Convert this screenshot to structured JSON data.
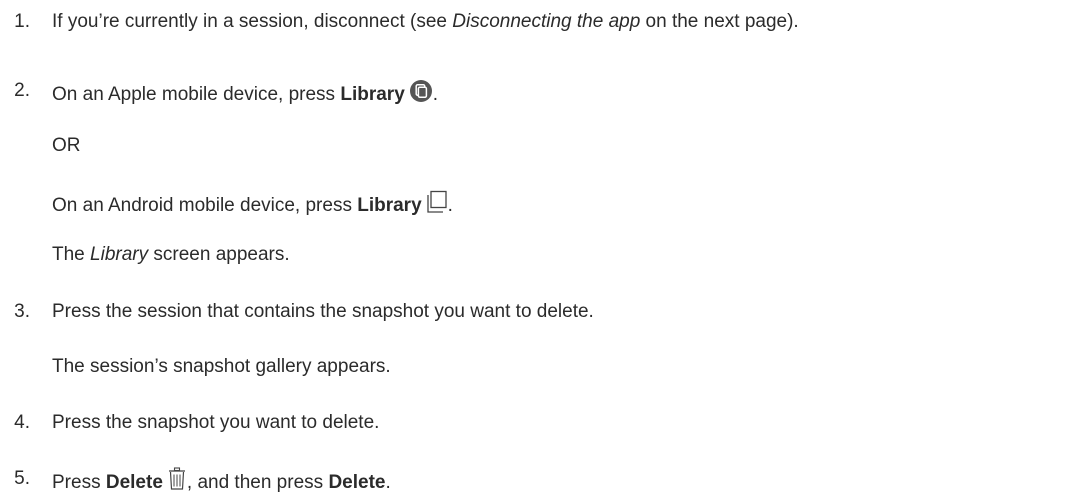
{
  "steps": [
    {
      "number": "1.",
      "text_before": "If you’re currently in a session, disconnect (see ",
      "text_italic": "Disconnecting the app",
      "text_after": " on the next page)."
    },
    {
      "number": "2.",
      "text_before": "On an Apple mobile device, press ",
      "bold": "Library",
      "text_after": ".",
      "icon": "library-circle-icon"
    },
    {
      "or": "OR"
    },
    {
      "text_before": "On an Android mobile device, press ",
      "bold": "Library",
      "text_after": ".",
      "icon": "library-outline-icon"
    },
    {
      "text_italic": "Library",
      "text_after": " screen appears.",
      "text_before": "The "
    },
    {
      "number": "3.",
      "text": "Press the session that contains the snapshot you want to delete."
    },
    {
      "text": "The session’s snapshot gallery appears."
    },
    {
      "number": "4.",
      "text": "Press the snapshot you want to delete."
    },
    {
      "number": "5.",
      "text_before": "Press ",
      "bold": "Delete",
      "text_middle": ", and then press ",
      "bold2": "Delete",
      "text_after": ".",
      "icon": "trash-icon"
    }
  ]
}
